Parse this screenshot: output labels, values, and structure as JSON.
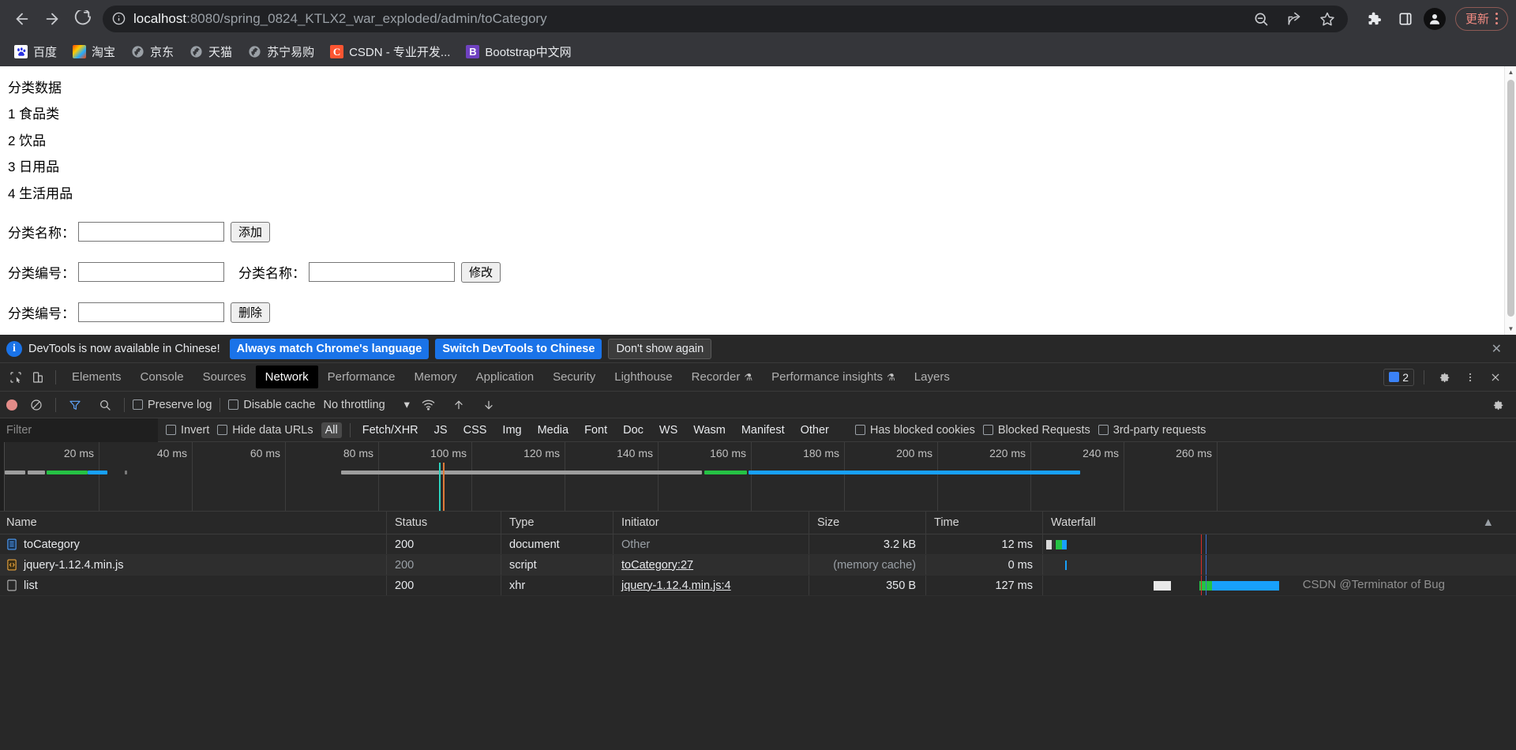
{
  "browser": {
    "url_host": "localhost",
    "url_rest": ":8080/spring_0824_KTLX2_war_exploded/admin/toCategory",
    "back_label": "Back",
    "forward_label": "Forward",
    "reload_label": "Reload",
    "site_info_label": "View site information",
    "search_label": "Search this page",
    "share_label": "Share this page",
    "bookmark_label": "Bookmark this tab",
    "extensions_label": "Extensions",
    "sidepanel_label": "Side panel",
    "profile_label": "Profile",
    "update_label": "更新",
    "menu_label": "Customize and control Chrome"
  },
  "bookmarks": [
    {
      "label": "百度",
      "icon": "baidu-icon"
    },
    {
      "label": "淘宝",
      "icon": "taobao-icon"
    },
    {
      "label": "京东",
      "icon": "globe-icon"
    },
    {
      "label": "天猫",
      "icon": "globe-icon"
    },
    {
      "label": "苏宁易购",
      "icon": "globe-icon"
    },
    {
      "label": "CSDN - 专业开发...",
      "icon": "csdn-icon",
      "glyph": "C"
    },
    {
      "label": "Bootstrap中文网",
      "icon": "bootstrap-icon",
      "glyph": "B"
    }
  ],
  "page": {
    "heading": "分类数据",
    "categories": [
      "1 食品类",
      "2 饮品",
      "3 日用品",
      "4 生活用品"
    ],
    "add_form": {
      "label": "分类名称：",
      "value": "",
      "button": "添加"
    },
    "edit_form": {
      "id_label": "分类编号：",
      "id_value": "",
      "name_label": "分类名称：",
      "name_value": "",
      "button": "修改"
    },
    "delete_form": {
      "id_label": "分类编号：",
      "id_value": "",
      "button": "删除"
    }
  },
  "devtools": {
    "banner": {
      "message": "DevTools is now available in Chinese!",
      "primary": "Always match Chrome's language",
      "secondary": "Switch DevTools to Chinese",
      "dismiss": "Don't show again",
      "close": "✕"
    },
    "tabs": [
      {
        "label": "Elements",
        "active": false
      },
      {
        "label": "Console",
        "active": false
      },
      {
        "label": "Sources",
        "active": false
      },
      {
        "label": "Network",
        "active": true
      },
      {
        "label": "Performance",
        "active": false
      },
      {
        "label": "Memory",
        "active": false
      },
      {
        "label": "Application",
        "active": false
      },
      {
        "label": "Security",
        "active": false
      },
      {
        "label": "Lighthouse",
        "active": false
      },
      {
        "label": "Recorder",
        "active": false,
        "flask": true
      },
      {
        "label": "Performance insights",
        "active": false,
        "flask": true
      },
      {
        "label": "Layers",
        "active": false
      }
    ],
    "issues_count": "2",
    "settings_label": "Settings",
    "more_label": "More options",
    "close_label": "Close DevTools",
    "toolbar": {
      "record_label": "Stop recording network log",
      "clear_label": "Clear network log",
      "filter_label": "Filter",
      "search_label": "Search",
      "preserve_log": "Preserve log",
      "disable_cache": "Disable cache",
      "throttling": "No throttling",
      "throttling_caret": "▾",
      "wifi_label": "Network conditions",
      "import_label": "Import HAR file",
      "export_label": "Export HAR file",
      "settings_label": "Network settings"
    },
    "filterbar": {
      "placeholder": "Filter",
      "value": "",
      "invert": "Invert",
      "hide_data_urls": "Hide data URLs",
      "types": [
        "All",
        "Fetch/XHR",
        "JS",
        "CSS",
        "Img",
        "Media",
        "Font",
        "Doc",
        "WS",
        "Wasm",
        "Manifest",
        "Other"
      ],
      "selected_type": "All",
      "has_blocked_cookies": "Has blocked cookies",
      "blocked_requests": "Blocked Requests",
      "third_party": "3rd-party requests"
    },
    "overview": {
      "ticks": [
        "20 ms",
        "40 ms",
        "60 ms",
        "80 ms",
        "100 ms",
        "120 ms",
        "140 ms",
        "160 ms",
        "180 ms",
        "200 ms",
        "220 ms",
        "240 ms",
        "260 ms"
      ]
    },
    "table": {
      "columns": [
        "Name",
        "Status",
        "Type",
        "Initiator",
        "Size",
        "Time",
        "Waterfall"
      ],
      "sort_indicator": "▲",
      "rows": [
        {
          "name": "toCategory",
          "icon": "document-icon",
          "status": "200",
          "status_muted": false,
          "type": "document",
          "initiator": "Other",
          "initiator_link": false,
          "size": "3.2 kB",
          "size_muted": false,
          "time": "12 ms",
          "time_muted": false
        },
        {
          "name": "jquery-1.12.4.min.js",
          "icon": "script-icon",
          "status": "200",
          "status_muted": true,
          "type": "script",
          "initiator": "toCategory:27",
          "initiator_link": true,
          "size": "(memory cache)",
          "size_muted": true,
          "time": "0 ms",
          "time_muted": false
        },
        {
          "name": "list",
          "icon": "xhr-icon",
          "status": "200",
          "status_muted": false,
          "type": "xhr",
          "initiator": "jquery-1.12.4.min.js:4",
          "initiator_link": true,
          "size": "350 B",
          "size_muted": false,
          "time": "127 ms",
          "time_muted": false
        }
      ]
    },
    "watermark": "CSDN @Terminator of Bug"
  },
  "colors": {
    "accent_blue": "#1a73e8",
    "waterfall_green": "#25c244",
    "waterfall_blue": "#18a0fb",
    "record_red": "#e38b88",
    "update_pill": "#f28b82"
  }
}
